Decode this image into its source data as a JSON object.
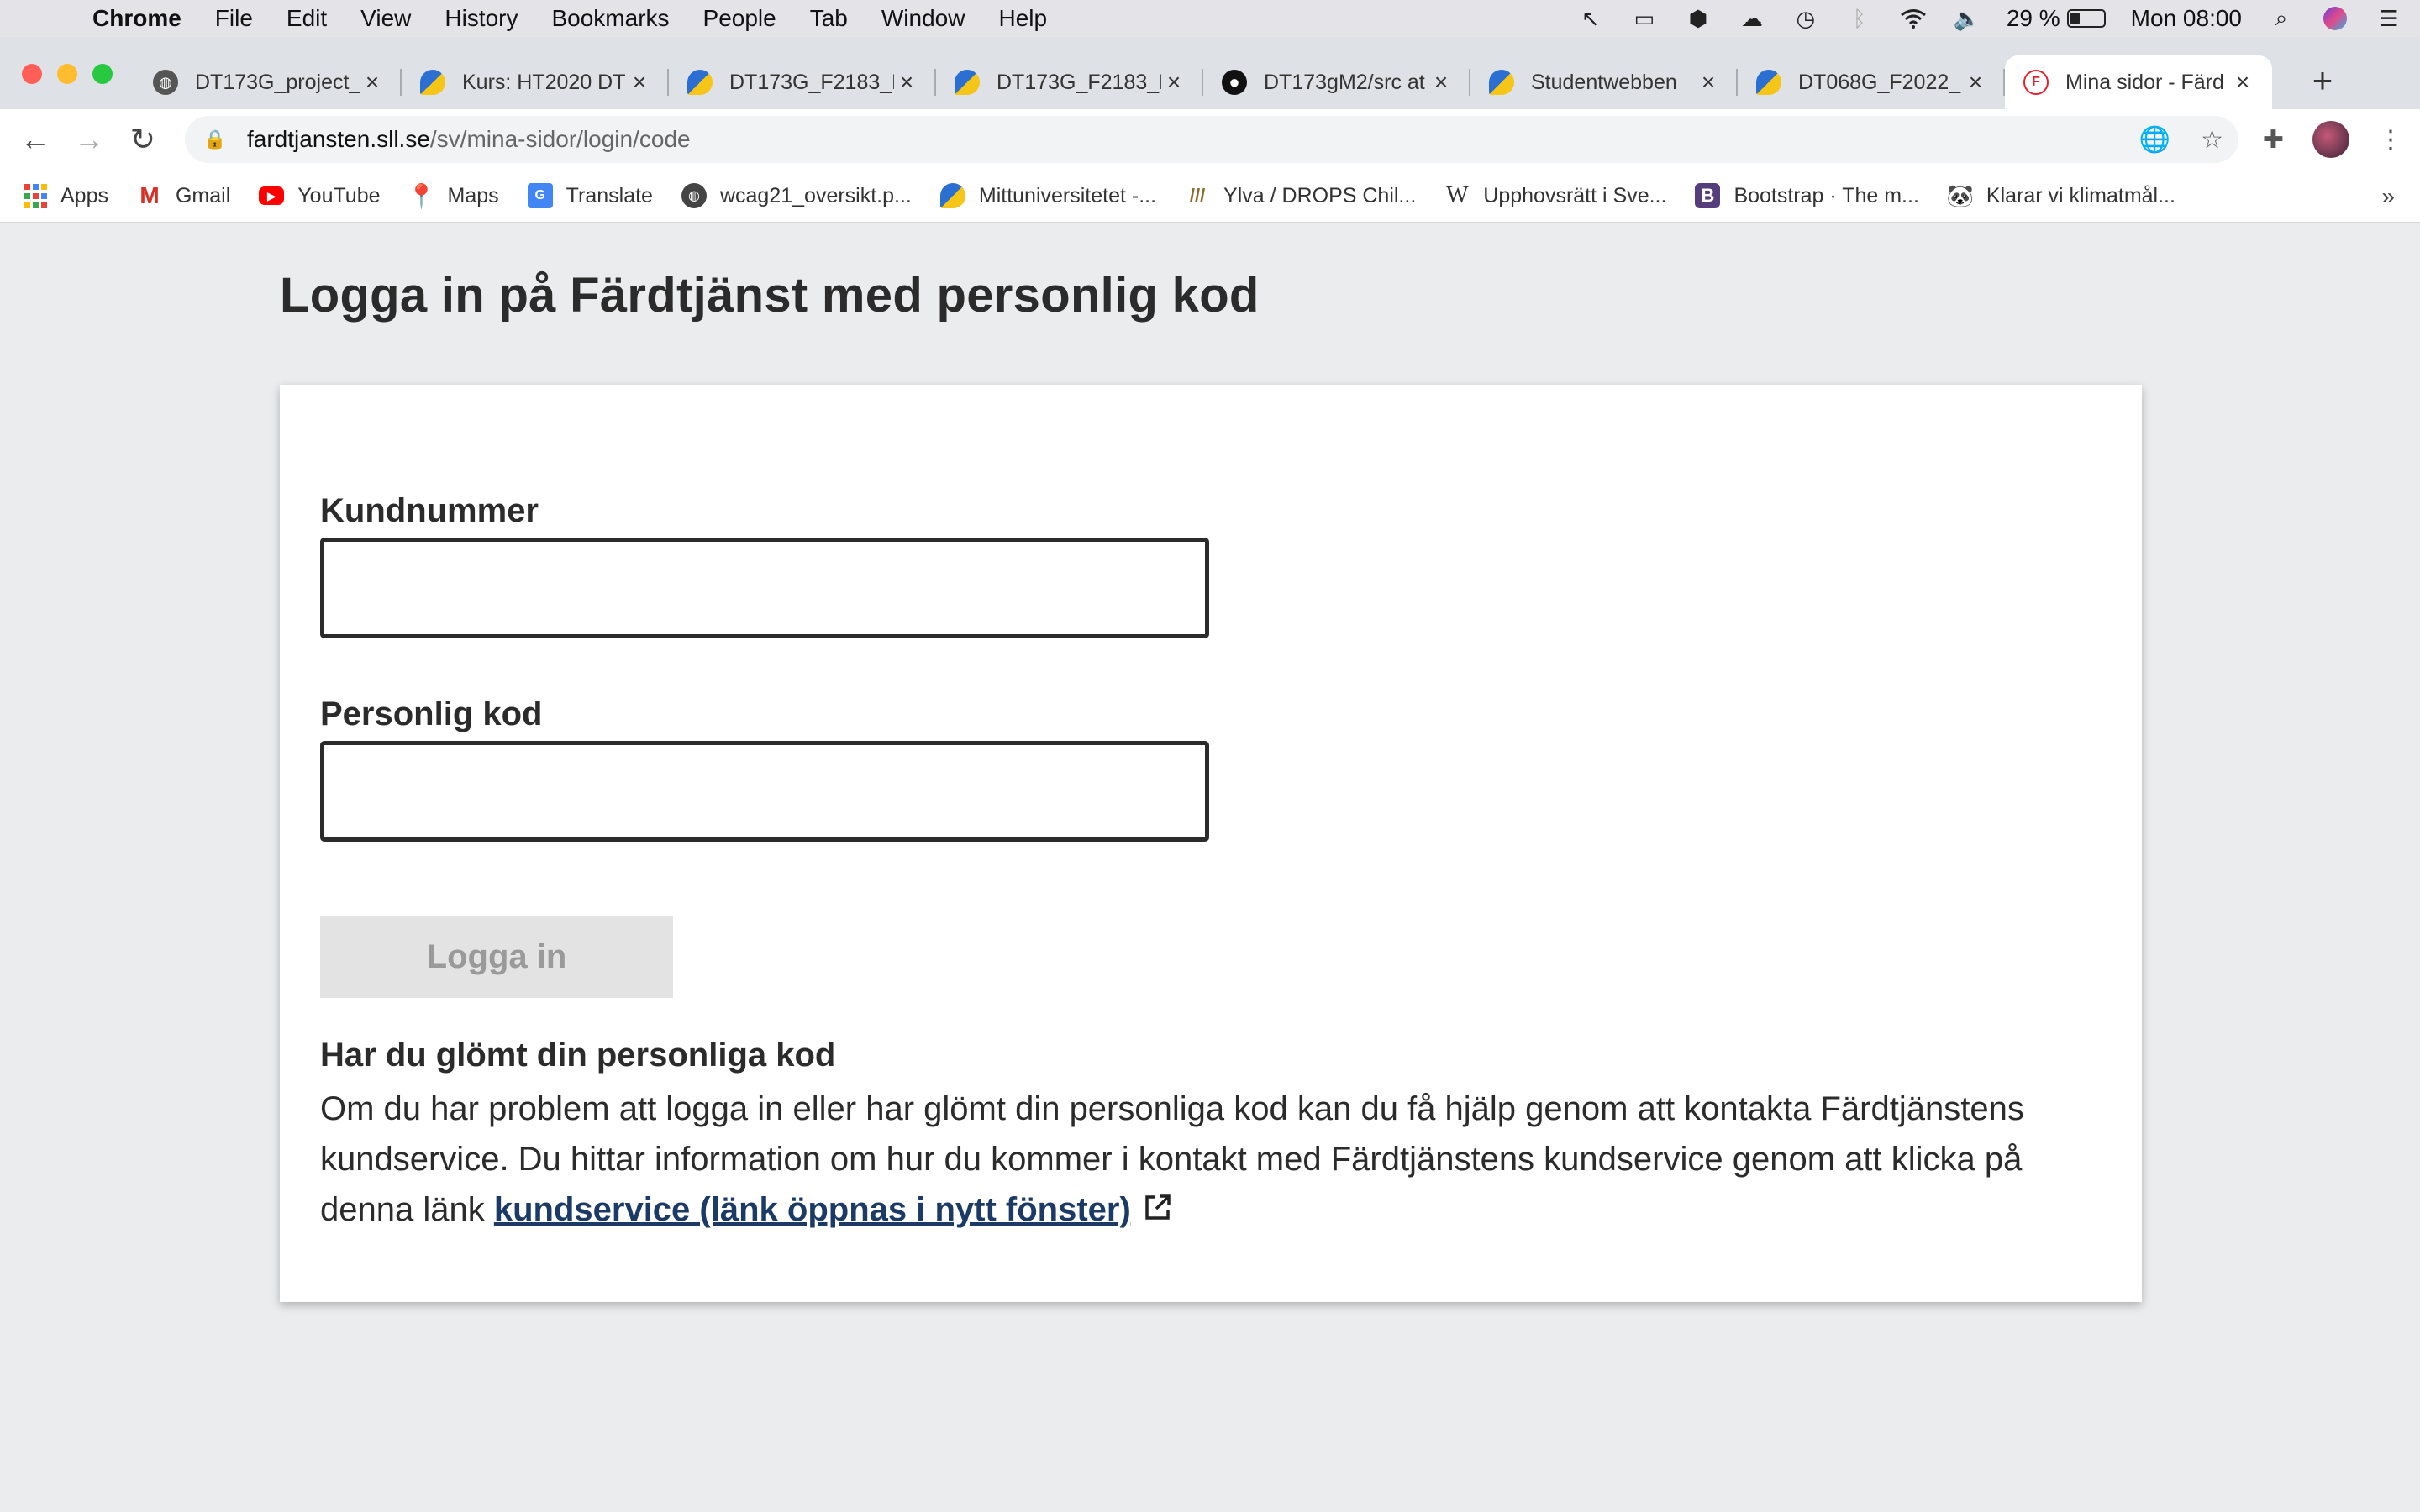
{
  "menubar": {
    "app": "Chrome",
    "items": [
      "File",
      "Edit",
      "View",
      "History",
      "Bookmarks",
      "People",
      "Tab",
      "Window",
      "Help"
    ],
    "battery": "29 %",
    "battery_level": 0.29,
    "clock": "Mon 08:00"
  },
  "tabs": [
    {
      "title": "DT173G_project_",
      "icon": "globe-icon"
    },
    {
      "title": "Kurs: HT2020 DT",
      "icon": "miun-icon"
    },
    {
      "title": "DT173G_F2183_H",
      "icon": "miun-icon"
    },
    {
      "title": "DT173G_F2183_H",
      "icon": "miun-icon"
    },
    {
      "title": "DT173gM2/src at",
      "icon": "github-icon"
    },
    {
      "title": "Studentwebben",
      "icon": "miun-icon"
    },
    {
      "title": "DT068G_F2022_",
      "icon": "miun-icon"
    },
    {
      "title": "Mina sidor - Färd",
      "icon": "fardtjansten-icon",
      "active": true
    }
  ],
  "address": {
    "host": "fardtjansten.sll.se",
    "path": "/sv/mina-sidor/login/code"
  },
  "bookmarks": [
    {
      "label": "Apps",
      "icon": "apps-grid-icon"
    },
    {
      "label": "Gmail",
      "icon": "gmail-icon"
    },
    {
      "label": "YouTube",
      "icon": "youtube-icon"
    },
    {
      "label": "Maps",
      "icon": "maps-pin-icon"
    },
    {
      "label": "Translate",
      "icon": "translate-icon"
    },
    {
      "label": "wcag21_oversikt.p...",
      "icon": "globe-icon"
    },
    {
      "label": "Mittuniversitetet -...",
      "icon": "miun-icon"
    },
    {
      "label": "Ylva / DROPS Chil...",
      "icon": "ylva-icon"
    },
    {
      "label": "Upphovsrätt i Sve...",
      "icon": "wikipedia-icon"
    },
    {
      "label": "Bootstrap · The m...",
      "icon": "bootstrap-icon"
    },
    {
      "label": "Klarar vi klimatmål...",
      "icon": "wwf-panda-icon"
    }
  ],
  "page": {
    "title": "Logga in på Färdtjänst med personlig kod",
    "customer_label": "Kundnummer",
    "customer_value": "",
    "code_label": "Personlig kod",
    "code_value": "",
    "login_button": "Logga in",
    "help_heading": "Har du glömt din personliga kod",
    "help_text": "Om du har problem att logga in eller har glömt din personliga kod kan du få hjälp genom att kontakta Färdtjänstens kundservice. Du hittar information om hur du kommer i kontakt med Färdtjänstens kundservice genom att klicka på denna länk ",
    "help_link": "kundservice (länk öppnas i nytt fönster)"
  }
}
